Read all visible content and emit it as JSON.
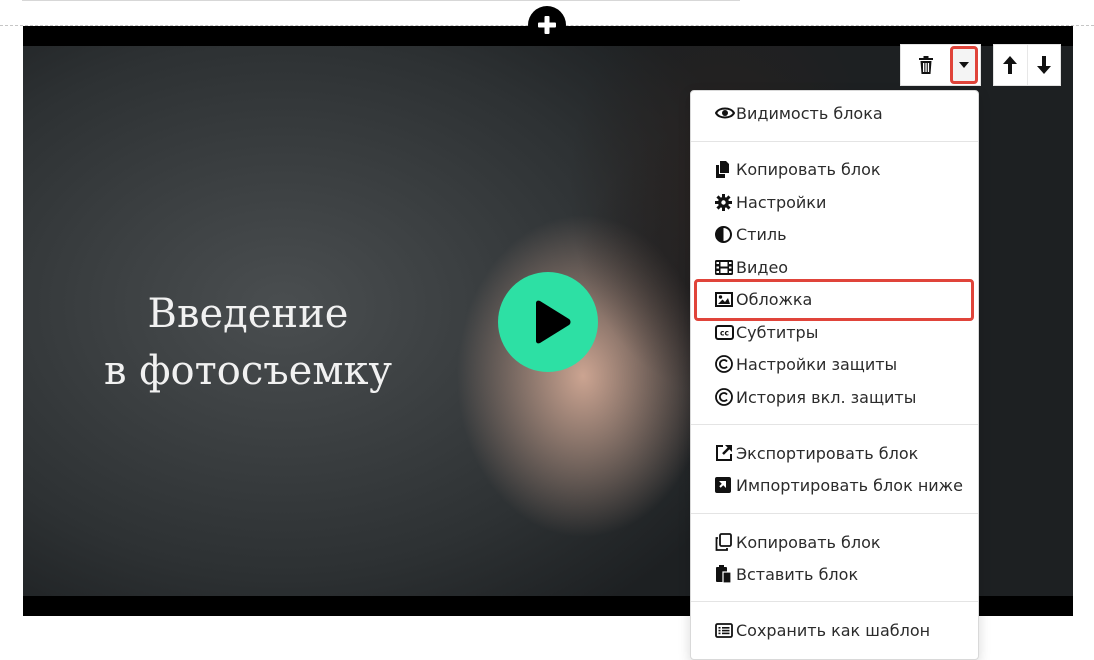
{
  "cover": {
    "title_line1": "Введение",
    "title_line2": "в фотосъемку",
    "play_icon": "play-icon"
  },
  "toolbar": {
    "add_icon": "plus-icon",
    "delete_icon": "trash-icon",
    "dropdown_icon": "caret-down-icon",
    "move_up_icon": "arrow-up-icon",
    "move_down_icon": "arrow-down-icon"
  },
  "menu": {
    "items": [
      {
        "label": "Видимость блока",
        "icon": "eye-icon"
      },
      {
        "label": "Копировать блок",
        "icon": "copy-file-icon"
      },
      {
        "label": "Настройки",
        "icon": "gear-icon"
      },
      {
        "label": "Стиль",
        "icon": "contrast-icon"
      },
      {
        "label": "Видео",
        "icon": "film-icon"
      },
      {
        "label": "Обложка",
        "icon": "image-icon"
      },
      {
        "label": "Субтитры",
        "icon": "closed-captions-icon"
      },
      {
        "label": "Настройки защиты",
        "icon": "copyright-icon"
      },
      {
        "label": "История вкл. защиты",
        "icon": "copyright-icon"
      },
      {
        "label": "Экспортировать блок",
        "icon": "external-link-icon"
      },
      {
        "label": "Импортировать блок ниже",
        "icon": "import-icon"
      },
      {
        "label": "Копировать блок",
        "icon": "clone-icon"
      },
      {
        "label": "Вставить блок",
        "icon": "paste-icon"
      },
      {
        "label": "Сохранить как шаблон",
        "icon": "list-icon"
      }
    ]
  },
  "colors": {
    "accent_red": "#e0443a",
    "play_green": "#2de0a4"
  }
}
